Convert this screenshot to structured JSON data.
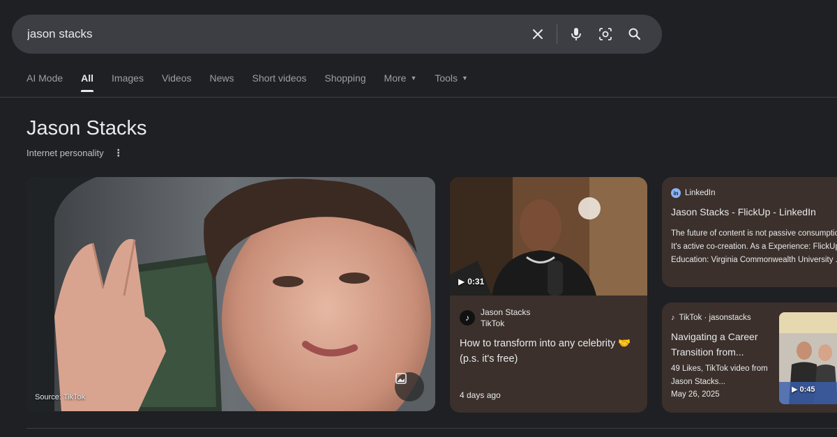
{
  "search": {
    "value": "jason stacks"
  },
  "tabs": [
    {
      "label": "AI Mode",
      "active": false
    },
    {
      "label": "All",
      "active": true
    },
    {
      "label": "Images",
      "active": false
    },
    {
      "label": "Videos",
      "active": false
    },
    {
      "label": "News",
      "active": false
    },
    {
      "label": "Short videos",
      "active": false
    },
    {
      "label": "Shopping",
      "active": false
    },
    {
      "label": "More",
      "active": false,
      "dropdown": true
    },
    {
      "label": "Tools",
      "active": false,
      "dropdown": true
    }
  ],
  "entity": {
    "name": "Jason Stacks",
    "description": "Internet personality"
  },
  "main_image": {
    "source": "Source: TikTok"
  },
  "video_card": {
    "duration": "0:31",
    "author": "Jason Stacks",
    "platform": "TikTok",
    "title": "How to transform into any celebrity 🤝 (p.s. it's free)",
    "date": "4 days ago"
  },
  "linkedin_card": {
    "source": "LinkedIn",
    "title": "Jason Stacks - FlickUp - LinkedIn",
    "snippet": "The future of content is not passive consumption. It's active co-creation. As a Experience: FlickUp · Education: Virginia Commonwealth University ..."
  },
  "tiktok_card": {
    "source": "TikTok · jasonstacks",
    "title": "Navigating a Career Transition from...",
    "snippet": "49 Likes, TikTok video from Jason Stacks...",
    "date": "May 26, 2025",
    "duration": "0:45"
  },
  "colors": {
    "background": "#1f2023",
    "search_bg": "#3c3e43",
    "card_bg": "#3b302b",
    "text_primary": "#e8eaed",
    "text_secondary": "#9aa0a6"
  }
}
